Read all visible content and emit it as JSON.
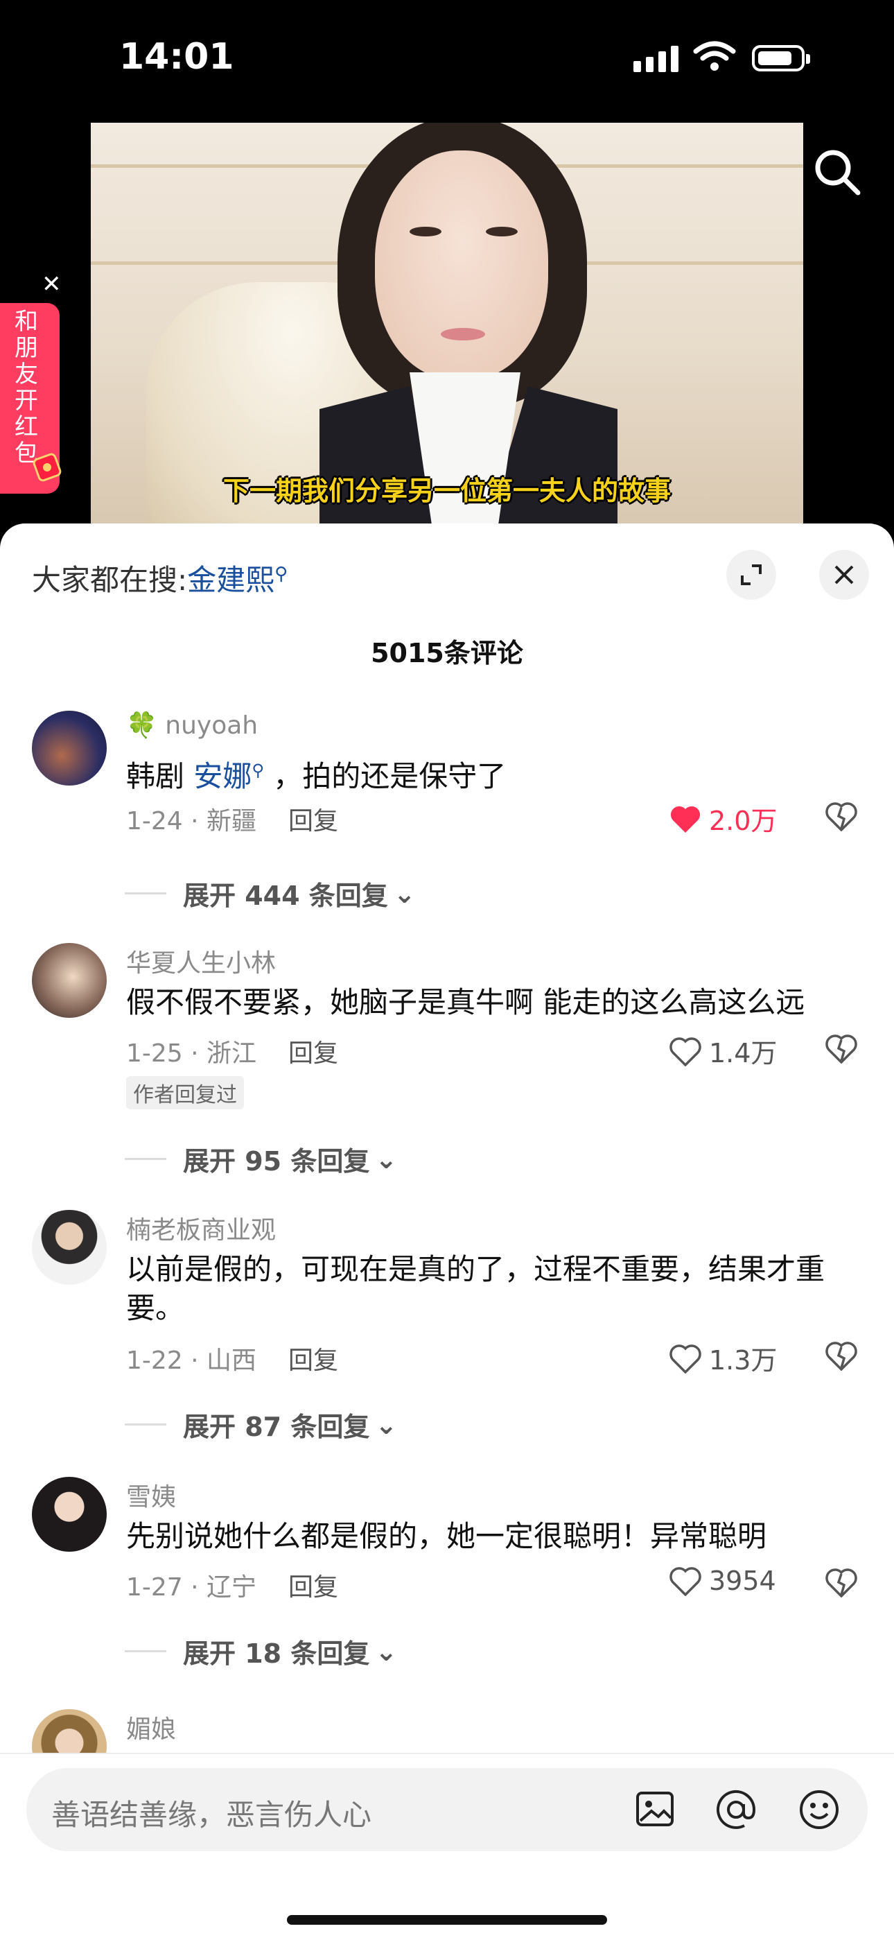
{
  "status_bar": {
    "time": "14:01"
  },
  "video": {
    "subtitle": "下一期我们分享另一位第一夫人的故事"
  },
  "red_packet": {
    "label": "和朋友开红包"
  },
  "hot_search": {
    "prefix": "大家都在搜:",
    "keyword": "金建熙"
  },
  "comment_count": "5015条评论",
  "comments": [
    {
      "user": "nuyoah",
      "text_before": "韩剧 ",
      "keyword": "安娜",
      "text_after": " ，拍的还是保守了",
      "date": "1-24 · 新疆",
      "reply": "回复",
      "likes": "2.0万",
      "liked": true,
      "expand": "展开 444 条回复"
    },
    {
      "user": "华夏人生小林",
      "text": "假不假不要紧，她脑子是真牛啊 能走的这么高这么远",
      "date": "1-25 · 浙江",
      "reply": "回复",
      "likes": "1.4万",
      "badge": "作者回复过",
      "expand": "展开 95 条回复"
    },
    {
      "user": "楠老板商业观",
      "text": "以前是假的，可现在是真的了，过程不重要，结果才重要。",
      "date": "1-22 · 山西",
      "reply": "回复",
      "likes": "1.3万",
      "expand": "展开 87 条回复"
    },
    {
      "user": "雪姨",
      "text": "先别说她什么都是假的，她一定很聪明！异常聪明",
      "date": "1-27 · 辽宁",
      "reply": "回复",
      "likes": "3954",
      "expand": "展开 18 条回复"
    },
    {
      "user": "媚娘"
    }
  ],
  "input": {
    "placeholder": "善语结善缘，恶言伤人心"
  },
  "colors": {
    "accent_red": "#ff2f55",
    "link_blue": "#1a4f9e",
    "subtitle_yellow": "#f6d21a",
    "redpack": "#ff3d60"
  }
}
